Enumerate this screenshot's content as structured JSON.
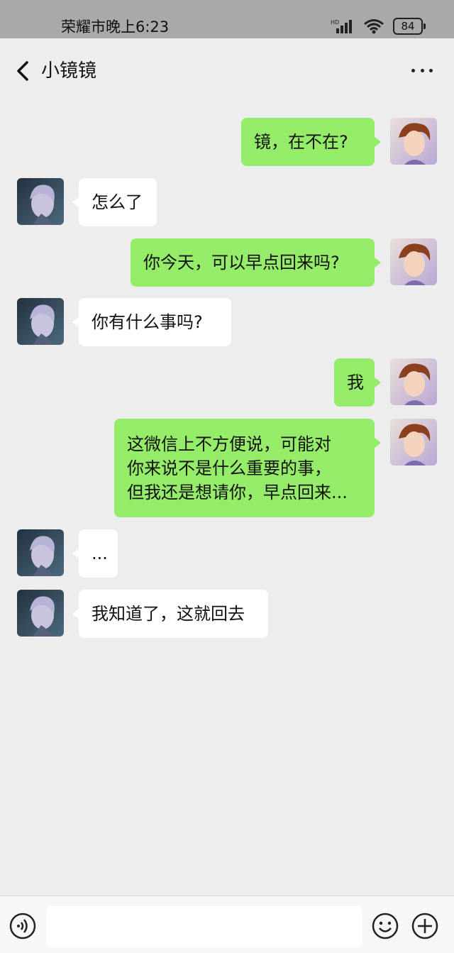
{
  "status_bar": {
    "time": "荣耀市晚上6:23",
    "network": "HD",
    "battery": "84"
  },
  "header": {
    "title": "小镜镜"
  },
  "messages": [
    {
      "side": "right",
      "lines": [
        "镜，在不在?"
      ]
    },
    {
      "side": "left",
      "lines": [
        "怎么了"
      ]
    },
    {
      "side": "right",
      "lines": [
        "你今天，可以早点回来吗?"
      ]
    },
    {
      "side": "left",
      "lines": [
        "你有什么事吗?"
      ]
    },
    {
      "side": "right",
      "lines": [
        "我"
      ]
    },
    {
      "side": "right",
      "lines": [
        "这微信上不方便说，可能对",
        "你来说不是什么重要的事，",
        "但我还是想请你，早点回来..."
      ]
    },
    {
      "side": "left",
      "lines": [
        "..."
      ]
    },
    {
      "side": "left",
      "lines": [
        "我知道了，这就回去"
      ]
    }
  ],
  "colors": {
    "outgoing_bubble": "#95ec69",
    "incoming_bubble": "#ffffff",
    "background": "#ededed"
  }
}
